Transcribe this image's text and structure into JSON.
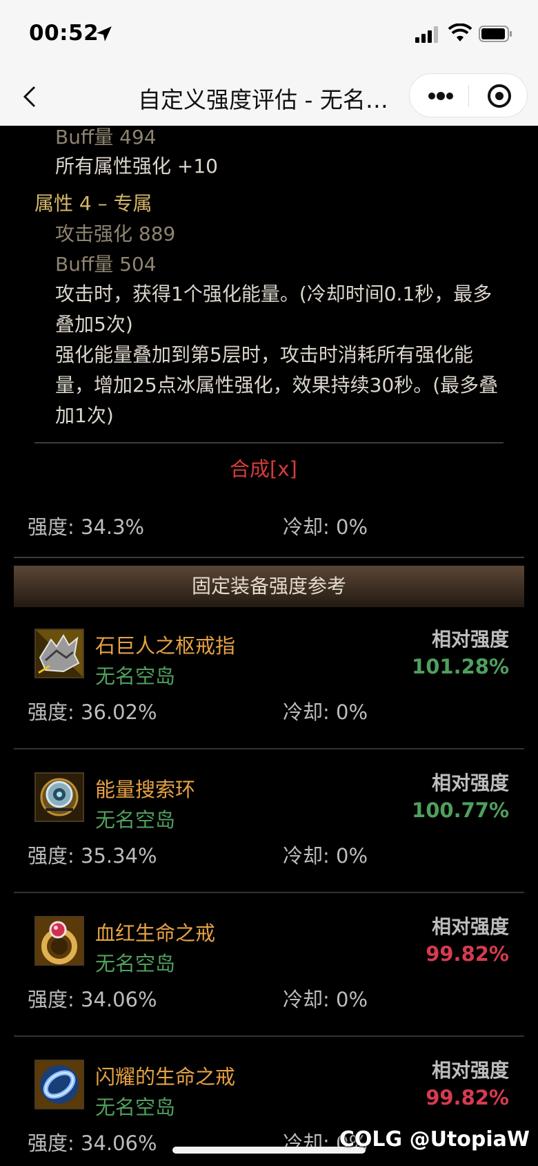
{
  "status_bar": {
    "time": "00:52"
  },
  "nav": {
    "title": "自定义强度评估 - 无名…"
  },
  "detail": {
    "buff_494": "Buff量  494",
    "all_attr": "所有属性强化 +10",
    "attr4_header": "属性 4 – 专属",
    "attack_889": "攻击强化  889",
    "buff_504": "Buff量  504",
    "effect_1": "攻击时，获得1个强化能量。(冷却时间0.1秒，最多叠加5次)",
    "effect_2": "强化能量叠加到第5层时，攻击时消耗所有强化能量，增加25点冰属性强化，效果持续30秒。(最多叠加1次)"
  },
  "synth": {
    "link": "合成[x]",
    "strength": "强度: 34.3%",
    "cooldown": "冷却: 0%"
  },
  "section": {
    "title": "固定装备强度参考"
  },
  "items": [
    {
      "name": "石巨人之枢戒指",
      "source": "无名空岛",
      "rel_label": "相对强度",
      "rel_value": "101.28%",
      "strength": "强度: 36.02%",
      "cooldown": "冷却: 0%",
      "rel_color": "#4fa05e",
      "icon": "golem-ring-icon"
    },
    {
      "name": "能量搜索环",
      "source": "无名空岛",
      "rel_label": "相对强度",
      "rel_value": "100.77%",
      "strength": "强度: 35.34%",
      "cooldown": "冷却: 0%",
      "rel_color": "#4fa05e",
      "icon": "energy-ring-icon"
    },
    {
      "name": "血红生命之戒",
      "source": "无名空岛",
      "rel_label": "相对强度",
      "rel_value": "99.82%",
      "strength": "强度: 34.06%",
      "cooldown": "冷却: 0%",
      "rel_color": "#d63b4f",
      "icon": "crimson-ring-icon"
    },
    {
      "name": "闪耀的生命之戒",
      "source": "无名空岛",
      "rel_label": "相对强度",
      "rel_value": "99.82%",
      "strength": "强度: 34.06%",
      "cooldown": "冷却: 0%",
      "rel_color": "#d63b4f",
      "icon": "shining-ring-icon"
    }
  ],
  "watermark": "COLG @UtopiaW"
}
